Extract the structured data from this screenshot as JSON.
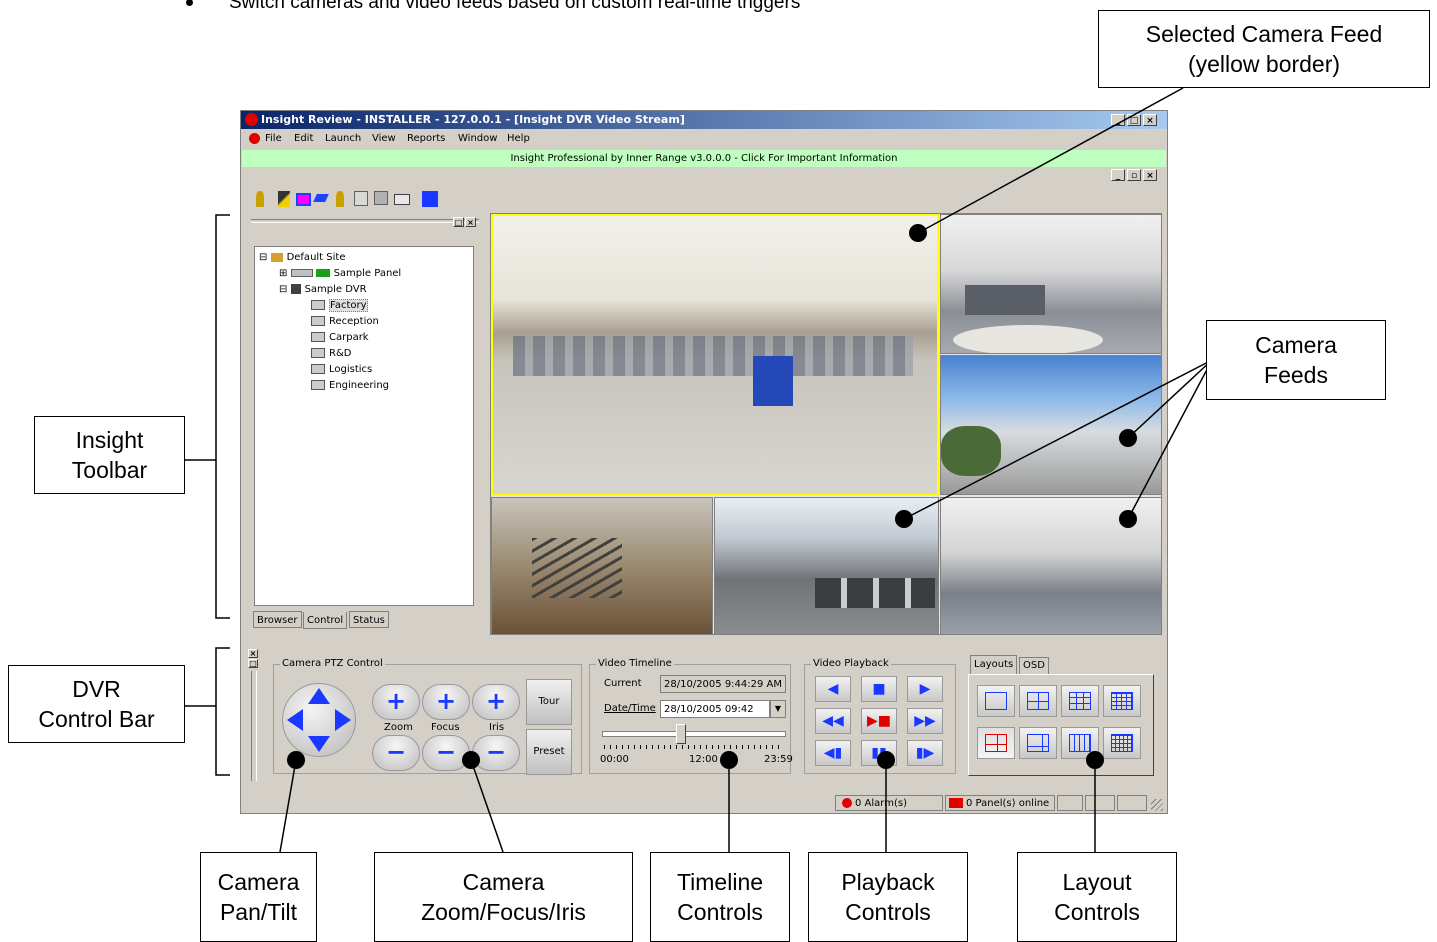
{
  "bullet_text": "Switch cameras and video feeds based on custom real-time triggers",
  "window": {
    "title": "Insight Review - INSTALLER - 127.0.0.1 - [Insight DVR Video Stream]",
    "menu": [
      "File",
      "Edit",
      "Launch",
      "View",
      "Reports",
      "Window",
      "Help"
    ],
    "info_banner": "Insight Professional by Inner Range v3.0.0.0 - Click For Important Information"
  },
  "tree": {
    "root": "Default Site",
    "panel": "Sample Panel",
    "dvr": "Sample DVR",
    "cameras": [
      "Factory",
      "Reception",
      "Carpark",
      "R&D",
      "Logistics",
      "Engineering"
    ]
  },
  "side_tabs": [
    "Browser",
    "Control",
    "Status"
  ],
  "ptz": {
    "group_label": "Camera PTZ Control",
    "zoom": "Zoom",
    "focus": "Focus",
    "iris": "Iris",
    "tour": "Tour",
    "preset": "Preset"
  },
  "timeline": {
    "group_label": "Video Timeline",
    "current_label": "Current",
    "current_value": "28/10/2005 9:44:29 AM",
    "datetime_label": "Date/Time",
    "datetime_value": "28/10/2005 09:42",
    "tick_start": "00:00",
    "tick_mid": "12:00",
    "tick_end": "23:59"
  },
  "playback": {
    "group_label": "Video Playback"
  },
  "layouts": {
    "tabs": [
      "Layouts",
      "OSD"
    ]
  },
  "status": {
    "alarms": "0 Alarm(s)",
    "panels": "0 Panel(s) online"
  },
  "callouts": {
    "selected_feed": "Selected Camera Feed\n(yellow border)",
    "camera_feeds": "Camera\nFeeds",
    "insight_toolbar": "Insight\nToolbar",
    "dvr_control_bar": "DVR\nControl Bar",
    "pan_tilt": "Camera\nPan/Tilt",
    "zoom_focus_iris": "Camera\nZoom/Focus/Iris",
    "timeline_controls": "Timeline\nControls",
    "playback_controls": "Playback\nControls",
    "layout_controls": "Layout\nControls"
  },
  "colors": {
    "selected_feed_border": "#ffff00",
    "info_banner_bg": "#bfffbf",
    "titlebar_start": "#0a246a",
    "control_blue": "#1a38ff",
    "alarm_red": "#e00000"
  }
}
